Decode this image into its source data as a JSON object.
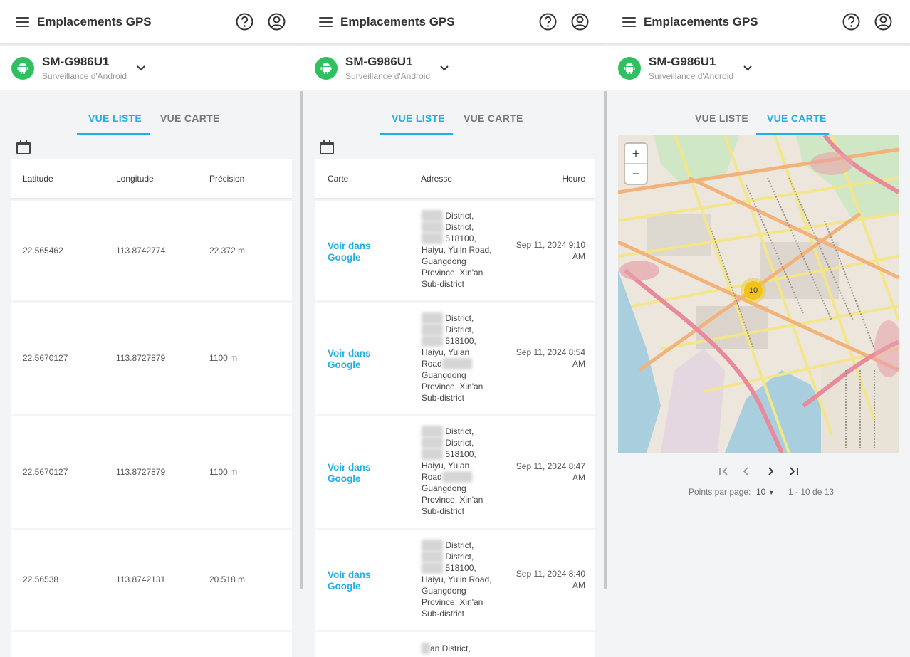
{
  "app_title": "Emplacements GPS",
  "device": {
    "name": "SM-G986U1",
    "subtitle": "Surveillance d'Android"
  },
  "tabs": {
    "list": "VUE LISTE",
    "map": "VUE CARTE"
  },
  "coords_table": {
    "headers": [
      "Latitude",
      "Longitude",
      "Précision"
    ],
    "rows": [
      {
        "lat": "22.565462",
        "lon": "113.8742774",
        "acc": "22.372 m"
      },
      {
        "lat": "22.5670127",
        "lon": "113.8727879",
        "acc": "1100 m"
      },
      {
        "lat": "22.5670127",
        "lon": "113.8727879",
        "acc": "1100 m"
      },
      {
        "lat": "22.56538",
        "lon": "113.8742131",
        "acc": "20.518 m"
      }
    ]
  },
  "address_table": {
    "headers": [
      "Carte",
      "Adresse",
      "Heure"
    ],
    "link_line1": "Voir dans",
    "link_line2": "Google",
    "rows": [
      {
        "addr": [
          " District,",
          " District,",
          " 518100,",
          "Haiyu, Yulin Road,",
          "Guangdong",
          "Province, Xin'an",
          "Sub-district"
        ],
        "time1": "Sep 11, 2024 9:10",
        "time2": "AM"
      },
      {
        "addr": [
          " District,",
          " District,",
          " 518100,",
          "Haiyu, Yulan",
          "Road",
          "Guangdong",
          "Province, Xin'an",
          "Sub-district"
        ],
        "time1": "Sep 11, 2024 8:54",
        "time2": "AM"
      },
      {
        "addr": [
          " District,",
          " District,",
          " 518100,",
          "Haiyu, Yulan",
          "Road",
          "Guangdong",
          "Province, Xin'an",
          "Sub-district"
        ],
        "time1": "Sep 11, 2024 8:47",
        "time2": "AM"
      },
      {
        "addr": [
          " District,",
          " District,",
          " 518100,",
          "Haiyu, Yulin Road,",
          "Guangdong",
          "Province, Xin'an",
          "Sub-district"
        ],
        "time1": "Sep 11, 2024 8:40",
        "time2": "AM"
      },
      {
        "addr": [
          "an District,"
        ],
        "time1": "",
        "time2": ""
      }
    ]
  },
  "map": {
    "zoom_in": "+",
    "zoom_out": "−",
    "cluster_count": "10",
    "pagination": {
      "per_page_label": "Points par page:",
      "per_page_value": "10",
      "range": "1 - 10 de 13"
    }
  },
  "colors": {
    "accent": "#22aee6",
    "android_green": "#2fc062",
    "cluster": "#f0c419"
  },
  "icons": [
    "menu-icon",
    "help-icon",
    "account-icon",
    "android-icon",
    "chevron-down-icon",
    "calendar-icon",
    "first-page-icon",
    "prev-page-icon",
    "next-page-icon",
    "last-page-icon"
  ]
}
